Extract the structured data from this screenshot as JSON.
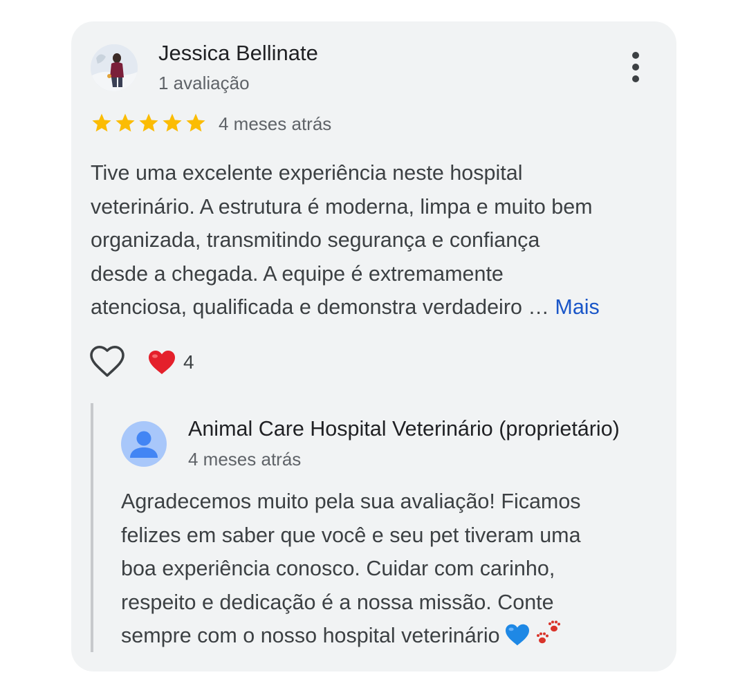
{
  "review": {
    "author_name": "Jessica Bellinate",
    "author_meta": "1 avaliação",
    "rating": 5,
    "rating_max": 5,
    "date": "4 meses atrás",
    "text_lines": [
      "Tive uma excelente experiência neste hospital",
      "veterinário. A estrutura é moderna, limpa e muito bem",
      "organizada, transmitindo segurança e confiança",
      "desde a chegada. A equipe é extremamente",
      "atenciosa, qualificada e demonstra verdadeiro …"
    ],
    "more_label": "Mais",
    "reaction_count": "4",
    "icons": {
      "menu": "more-vert-icon",
      "like": "heart-outline-icon",
      "reaction": "red-heart-icon",
      "star": "star-icon"
    },
    "colors": {
      "star": "#fbbc04",
      "link": "#1a56c8",
      "reaction": "#e4202b"
    }
  },
  "owner_reply": {
    "name": "Animal Care Hospital Veterinário (proprietário)",
    "date": "4 meses atrás",
    "text_lines": [
      "Agradecemos muito pela sua avaliação! Ficamos",
      "felizes em saber que você e seu pet tiveram uma",
      "boa experiência conosco. Cuidar com carinho,",
      "respeito e dedicação é a nossa missão. Conte",
      "sempre com o nosso hospital veterinário"
    ],
    "icons": {
      "avatar": "person-icon",
      "emojis": [
        "blue-heart-icon",
        "paw-prints-icon"
      ]
    },
    "colors": {
      "avatar_bg": "#a8c7fa",
      "avatar_fg": "#4285f4",
      "emoji_heart": "#1e88e5",
      "emoji_paw": "#d9342b"
    }
  }
}
